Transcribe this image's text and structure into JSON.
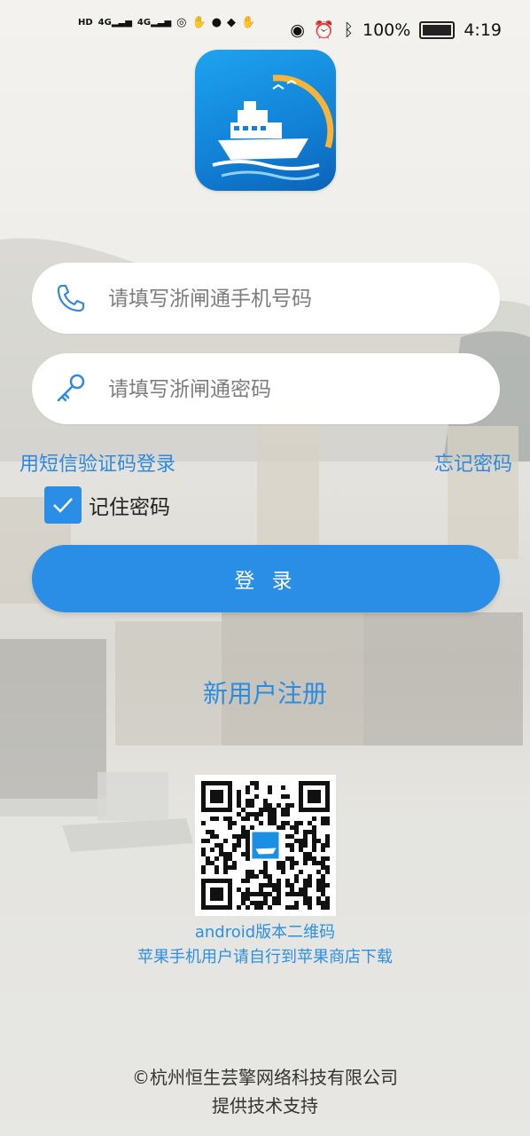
{
  "status_bar": {
    "left_labels": [
      "HD",
      "4G",
      "4G"
    ],
    "battery": "100%",
    "time": "4:19",
    "icons": [
      "hd-icon",
      "signal-icon",
      "signal-icon",
      "wifi-calling-icon",
      "hand-icon",
      "chat-icon",
      "shield-icon",
      "hand-icon",
      "eye-icon",
      "alarm-icon",
      "bluetooth-icon",
      "battery-icon"
    ]
  },
  "app": {
    "logo": "ship-logo-icon"
  },
  "login": {
    "phone_placeholder": "请填写浙闸通手机号码",
    "password_placeholder": "请填写浙闸通密码",
    "sms_login_label": "用短信验证码登录",
    "forgot_password_label": "忘记密码",
    "remember_label": "记住密码",
    "remember_checked": true,
    "submit_label": "登 录",
    "register_label": "新用户注册"
  },
  "qr": {
    "caption_line1": "android版本二维码",
    "caption_line2": "苹果手机用户请自行到苹果商店下载"
  },
  "footer": {
    "line1": "©杭州恒生芸擎网络科技有限公司",
    "line2": "提供技术支持"
  },
  "colors": {
    "accent": "#2a8de6",
    "link": "#2d8ae0",
    "logo_blue": "#1281d6"
  }
}
